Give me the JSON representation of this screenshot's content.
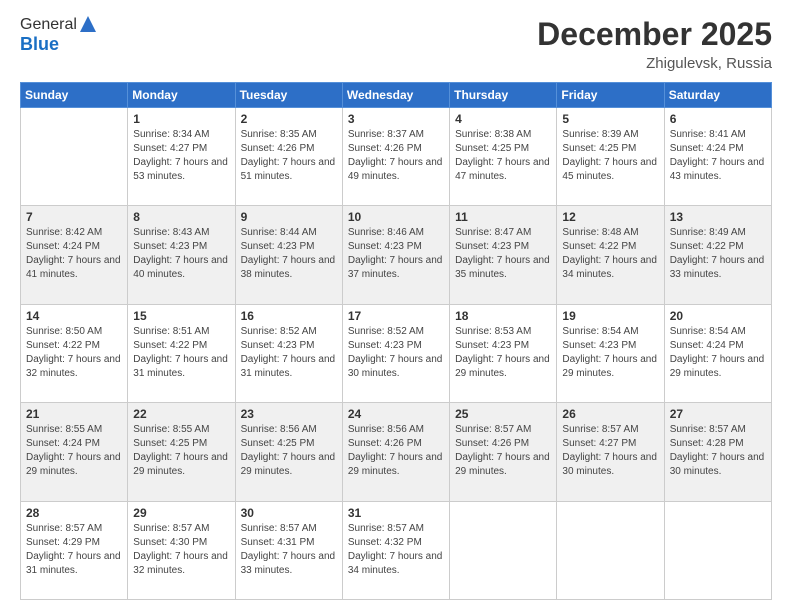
{
  "header": {
    "logo_general": "General",
    "logo_blue": "Blue",
    "month_title": "December 2025",
    "location": "Zhigulevsk, Russia"
  },
  "days_of_week": [
    "Sunday",
    "Monday",
    "Tuesday",
    "Wednesday",
    "Thursday",
    "Friday",
    "Saturday"
  ],
  "weeks": [
    [
      {
        "day": "",
        "sunrise": "",
        "sunset": "",
        "daylight": ""
      },
      {
        "day": "1",
        "sunrise": "Sunrise: 8:34 AM",
        "sunset": "Sunset: 4:27 PM",
        "daylight": "Daylight: 7 hours and 53 minutes."
      },
      {
        "day": "2",
        "sunrise": "Sunrise: 8:35 AM",
        "sunset": "Sunset: 4:26 PM",
        "daylight": "Daylight: 7 hours and 51 minutes."
      },
      {
        "day": "3",
        "sunrise": "Sunrise: 8:37 AM",
        "sunset": "Sunset: 4:26 PM",
        "daylight": "Daylight: 7 hours and 49 minutes."
      },
      {
        "day": "4",
        "sunrise": "Sunrise: 8:38 AM",
        "sunset": "Sunset: 4:25 PM",
        "daylight": "Daylight: 7 hours and 47 minutes."
      },
      {
        "day": "5",
        "sunrise": "Sunrise: 8:39 AM",
        "sunset": "Sunset: 4:25 PM",
        "daylight": "Daylight: 7 hours and 45 minutes."
      },
      {
        "day": "6",
        "sunrise": "Sunrise: 8:41 AM",
        "sunset": "Sunset: 4:24 PM",
        "daylight": "Daylight: 7 hours and 43 minutes."
      }
    ],
    [
      {
        "day": "7",
        "sunrise": "Sunrise: 8:42 AM",
        "sunset": "Sunset: 4:24 PM",
        "daylight": "Daylight: 7 hours and 41 minutes."
      },
      {
        "day": "8",
        "sunrise": "Sunrise: 8:43 AM",
        "sunset": "Sunset: 4:23 PM",
        "daylight": "Daylight: 7 hours and 40 minutes."
      },
      {
        "day": "9",
        "sunrise": "Sunrise: 8:44 AM",
        "sunset": "Sunset: 4:23 PM",
        "daylight": "Daylight: 7 hours and 38 minutes."
      },
      {
        "day": "10",
        "sunrise": "Sunrise: 8:46 AM",
        "sunset": "Sunset: 4:23 PM",
        "daylight": "Daylight: 7 hours and 37 minutes."
      },
      {
        "day": "11",
        "sunrise": "Sunrise: 8:47 AM",
        "sunset": "Sunset: 4:23 PM",
        "daylight": "Daylight: 7 hours and 35 minutes."
      },
      {
        "day": "12",
        "sunrise": "Sunrise: 8:48 AM",
        "sunset": "Sunset: 4:22 PM",
        "daylight": "Daylight: 7 hours and 34 minutes."
      },
      {
        "day": "13",
        "sunrise": "Sunrise: 8:49 AM",
        "sunset": "Sunset: 4:22 PM",
        "daylight": "Daylight: 7 hours and 33 minutes."
      }
    ],
    [
      {
        "day": "14",
        "sunrise": "Sunrise: 8:50 AM",
        "sunset": "Sunset: 4:22 PM",
        "daylight": "Daylight: 7 hours and 32 minutes."
      },
      {
        "day": "15",
        "sunrise": "Sunrise: 8:51 AM",
        "sunset": "Sunset: 4:22 PM",
        "daylight": "Daylight: 7 hours and 31 minutes."
      },
      {
        "day": "16",
        "sunrise": "Sunrise: 8:52 AM",
        "sunset": "Sunset: 4:23 PM",
        "daylight": "Daylight: 7 hours and 31 minutes."
      },
      {
        "day": "17",
        "sunrise": "Sunrise: 8:52 AM",
        "sunset": "Sunset: 4:23 PM",
        "daylight": "Daylight: 7 hours and 30 minutes."
      },
      {
        "day": "18",
        "sunrise": "Sunrise: 8:53 AM",
        "sunset": "Sunset: 4:23 PM",
        "daylight": "Daylight: 7 hours and 29 minutes."
      },
      {
        "day": "19",
        "sunrise": "Sunrise: 8:54 AM",
        "sunset": "Sunset: 4:23 PM",
        "daylight": "Daylight: 7 hours and 29 minutes."
      },
      {
        "day": "20",
        "sunrise": "Sunrise: 8:54 AM",
        "sunset": "Sunset: 4:24 PM",
        "daylight": "Daylight: 7 hours and 29 minutes."
      }
    ],
    [
      {
        "day": "21",
        "sunrise": "Sunrise: 8:55 AM",
        "sunset": "Sunset: 4:24 PM",
        "daylight": "Daylight: 7 hours and 29 minutes."
      },
      {
        "day": "22",
        "sunrise": "Sunrise: 8:55 AM",
        "sunset": "Sunset: 4:25 PM",
        "daylight": "Daylight: 7 hours and 29 minutes."
      },
      {
        "day": "23",
        "sunrise": "Sunrise: 8:56 AM",
        "sunset": "Sunset: 4:25 PM",
        "daylight": "Daylight: 7 hours and 29 minutes."
      },
      {
        "day": "24",
        "sunrise": "Sunrise: 8:56 AM",
        "sunset": "Sunset: 4:26 PM",
        "daylight": "Daylight: 7 hours and 29 minutes."
      },
      {
        "day": "25",
        "sunrise": "Sunrise: 8:57 AM",
        "sunset": "Sunset: 4:26 PM",
        "daylight": "Daylight: 7 hours and 29 minutes."
      },
      {
        "day": "26",
        "sunrise": "Sunrise: 8:57 AM",
        "sunset": "Sunset: 4:27 PM",
        "daylight": "Daylight: 7 hours and 30 minutes."
      },
      {
        "day": "27",
        "sunrise": "Sunrise: 8:57 AM",
        "sunset": "Sunset: 4:28 PM",
        "daylight": "Daylight: 7 hours and 30 minutes."
      }
    ],
    [
      {
        "day": "28",
        "sunrise": "Sunrise: 8:57 AM",
        "sunset": "Sunset: 4:29 PM",
        "daylight": "Daylight: 7 hours and 31 minutes."
      },
      {
        "day": "29",
        "sunrise": "Sunrise: 8:57 AM",
        "sunset": "Sunset: 4:30 PM",
        "daylight": "Daylight: 7 hours and 32 minutes."
      },
      {
        "day": "30",
        "sunrise": "Sunrise: 8:57 AM",
        "sunset": "Sunset: 4:31 PM",
        "daylight": "Daylight: 7 hours and 33 minutes."
      },
      {
        "day": "31",
        "sunrise": "Sunrise: 8:57 AM",
        "sunset": "Sunset: 4:32 PM",
        "daylight": "Daylight: 7 hours and 34 minutes."
      },
      {
        "day": "",
        "sunrise": "",
        "sunset": "",
        "daylight": ""
      },
      {
        "day": "",
        "sunrise": "",
        "sunset": "",
        "daylight": ""
      },
      {
        "day": "",
        "sunrise": "",
        "sunset": "",
        "daylight": ""
      }
    ]
  ]
}
